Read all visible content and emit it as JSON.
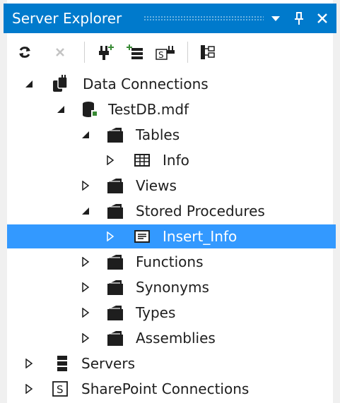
{
  "panel": {
    "title": "Server Explorer",
    "accent_color": "#007acc",
    "selection_color": "#3399ff"
  },
  "titlebar_buttons": [
    {
      "icon": "dropdown-arrow-icon",
      "glyph": "▼"
    },
    {
      "icon": "pin-icon",
      "glyph": "📌"
    },
    {
      "icon": "close-icon",
      "glyph": "✕"
    }
  ],
  "toolbar": {
    "items": [
      {
        "icon": "refresh-icon",
        "enabled": true
      },
      {
        "icon": "stop-icon",
        "enabled": false
      },
      {
        "icon": "connect-to-database-icon",
        "enabled": true
      },
      {
        "icon": "connect-to-server-icon",
        "enabled": true
      },
      {
        "icon": "connect-to-sharepoint-icon",
        "enabled": true
      },
      {
        "icon": "object-browser-icon",
        "enabled": true
      }
    ]
  },
  "tree": {
    "nodes": [
      {
        "label": "Data Connections",
        "expanded": true,
        "icon": "data-connections-icon"
      },
      {
        "label": "TestDB.mdf",
        "expanded": true,
        "icon": "database-icon"
      },
      {
        "label": "Tables",
        "expanded": true,
        "icon": "folder-icon"
      },
      {
        "label": "Info",
        "expanded": false,
        "icon": "table-icon"
      },
      {
        "label": "Views",
        "expanded": false,
        "icon": "folder-icon"
      },
      {
        "label": "Stored Procedures",
        "expanded": true,
        "icon": "folder-icon"
      },
      {
        "label": "Insert_Info",
        "expanded": false,
        "icon": "stored-procedure-icon",
        "selected": true
      },
      {
        "label": "Functions",
        "expanded": false,
        "icon": "folder-icon"
      },
      {
        "label": "Synonyms",
        "expanded": false,
        "icon": "folder-icon"
      },
      {
        "label": "Types",
        "expanded": false,
        "icon": "folder-icon"
      },
      {
        "label": "Assemblies",
        "expanded": false,
        "icon": "folder-icon"
      },
      {
        "label": "Servers",
        "expanded": false,
        "icon": "servers-icon"
      },
      {
        "label": "SharePoint Connections",
        "expanded": false,
        "icon": "sharepoint-icon"
      }
    ]
  }
}
